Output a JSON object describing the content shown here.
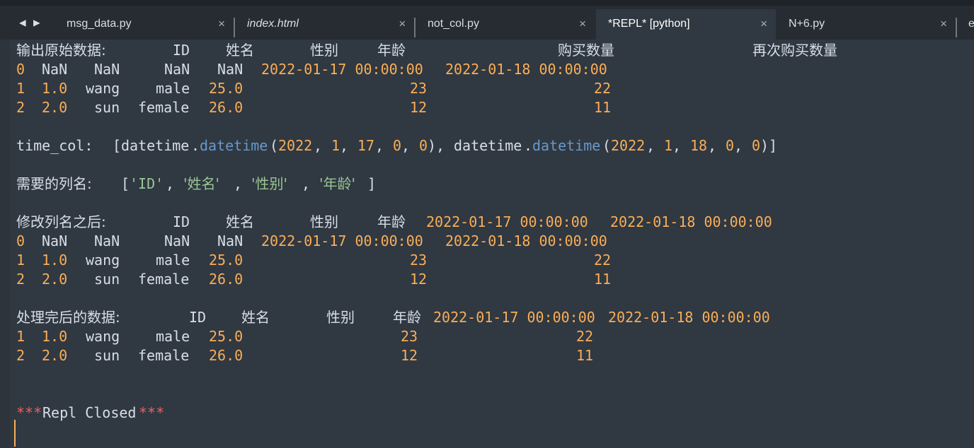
{
  "tabs": [
    {
      "label": "msg_data.py",
      "close": "×"
    },
    {
      "label": "index.html",
      "close": "×"
    },
    {
      "label": "not_col.py",
      "close": "×"
    },
    {
      "label": "*REPL* [python]",
      "close": "×"
    },
    {
      "label": "N+6.py",
      "close": "×"
    },
    {
      "label": "e"
    }
  ],
  "nav": {
    "back": "◀",
    "forward": "▶"
  },
  "output": {
    "original": {
      "label": "输出原始数据:",
      "headers": [
        "ID",
        "姓名",
        "性别",
        "年龄",
        "购买数量",
        "再次购买数量"
      ],
      "rows": [
        [
          "0",
          "NaN",
          "NaN",
          "NaN",
          "NaN",
          "2022-01-17 00:00:00",
          "2022-01-18 00:00:00"
        ],
        [
          "1",
          "1.0",
          "wang",
          "male",
          "25.0",
          "23",
          "22"
        ],
        [
          "2",
          "2.0",
          "sun",
          "female",
          "26.0",
          "12",
          "11"
        ]
      ]
    },
    "time_col": {
      "label": "time_col:",
      "open": "[",
      "mod": "datetime",
      "dot": ".",
      "func": "datetime",
      "lp": "(",
      "rp": ")",
      "comma": ",",
      "close": "]",
      "args1": [
        "2022",
        "1",
        "17",
        "0",
        "0"
      ],
      "args2": [
        "2022",
        "1",
        "18",
        "0",
        "0"
      ]
    },
    "needed": {
      "label": "需要的列名:",
      "open": "[",
      "close": "]",
      "comma": ",",
      "items": [
        "'ID'",
        "'姓名'",
        "'性别'",
        "'年龄'"
      ]
    },
    "renamed": {
      "label": "修改列名之后:",
      "headers": [
        "ID",
        "姓名",
        "性别",
        "年龄",
        "2022-01-17 00:00:00",
        "2022-01-18 00:00:00"
      ],
      "rows": [
        [
          "0",
          "NaN",
          "NaN",
          "NaN",
          "NaN",
          "2022-01-17 00:00:00",
          "2022-01-18 00:00:00"
        ],
        [
          "1",
          "1.0",
          "wang",
          "male",
          "25.0",
          "23",
          "22"
        ],
        [
          "2",
          "2.0",
          "sun",
          "female",
          "26.0",
          "12",
          "11"
        ]
      ]
    },
    "processed": {
      "label": "处理完后的数据:",
      "headers": [
        "ID",
        "姓名",
        "性别",
        "年龄",
        "2022-01-17 00:00:00",
        "2022-01-18 00:00:00"
      ],
      "rows": [
        [
          "1",
          "1.0",
          "wang",
          "male",
          "25.0",
          "23",
          "22"
        ],
        [
          "2",
          "2.0",
          "sun",
          "female",
          "26.0",
          "12",
          "11"
        ]
      ]
    },
    "closed": {
      "stars": "***",
      "text": "Repl Closed"
    }
  }
}
